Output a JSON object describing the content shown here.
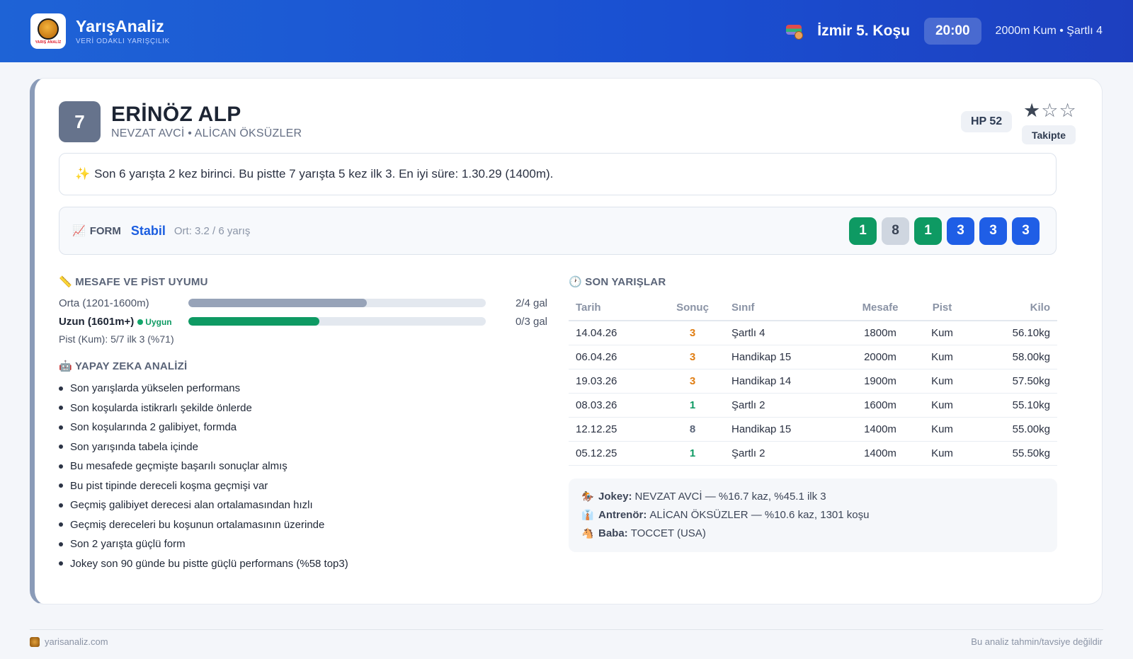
{
  "header": {
    "brand_name": "YarışAnaliz",
    "brand_tagline": "VERİ ODAKLI YARIŞÇILIK",
    "logo_mini": "YARIŞ ANALİZ",
    "race_title": "İzmir 5. Koşu",
    "race_time": "20:00",
    "race_info": "2000m Kum • Şartlı 4"
  },
  "horse": {
    "number": "7",
    "name": "ERİNÖZ ALP",
    "subtitle": "NEVZAT AVCİ • ALİCAN ÖKSÜZLER",
    "hp": "HP 52",
    "rating_stars": 1,
    "stars": "★☆☆",
    "follow_label": "Takipte"
  },
  "summary": "Son 6 yarışta 2 kez birinci. Bu pistte 7 yarışta 5 kez ilk 3. En iyi süre: 1.30.29 (1400m).",
  "form": {
    "label": "FORM",
    "state": "Stabil",
    "avg": "Ort: 3.2 / 6 yarış",
    "results": [
      "1",
      "8",
      "1",
      "3",
      "3",
      "3"
    ]
  },
  "distance": {
    "title": "MESAFE VE PİST UYUMU",
    "rows": [
      {
        "label": "Orta (1201-1600m)",
        "value": "2/4 gal",
        "fill": 0.6,
        "color": "#97a3b8",
        "tag": ""
      },
      {
        "label": "Uzun (1601m+)",
        "value": "0/3 gal",
        "fill": 0.44,
        "color": "#0e9a63",
        "tag": "Uygun"
      }
    ],
    "pist_note": "Pist (Kum): 5/7 ilk 3 (%71)"
  },
  "ai": {
    "title": "YAPAY ZEKA ANALİZİ",
    "items": [
      "Son yarışlarda yükselen performans",
      "Son koşularda istikrarlı şekilde önlerde",
      "Son koşularında 2 galibiyet, formda",
      "Son yarışında tabela içinde",
      "Bu mesafede geçmişte başarılı sonuçlar almış",
      "Bu pist tipinde dereceli koşma geçmişi var",
      "Geçmiş galibiyet derecesi alan ortalamasından hızlı",
      "Geçmiş dereceleri bu koşunun ortalamasının üzerinde",
      "Son 2 yarışta güçlü form",
      "Jokey son 90 günde bu pistte güçlü performans (%58 top3)"
    ]
  },
  "races": {
    "title": "SON YARIŞLAR",
    "headers": {
      "date": "Tarih",
      "result": "Sonuç",
      "class": "Sınıf",
      "distance": "Mesafe",
      "track": "Pist",
      "weight": "Kilo"
    },
    "rows": [
      {
        "date": "14.04.26",
        "result": "3",
        "class": "Şartlı 4",
        "distance": "1800m",
        "track": "Kum",
        "weight": "56.10kg"
      },
      {
        "date": "06.04.26",
        "result": "3",
        "class": "Handikap 15",
        "distance": "2000m",
        "track": "Kum",
        "weight": "58.00kg"
      },
      {
        "date": "19.03.26",
        "result": "3",
        "class": "Handikap 14",
        "distance": "1900m",
        "track": "Kum",
        "weight": "57.50kg"
      },
      {
        "date": "08.03.26",
        "result": "1",
        "class": "Şartlı 2",
        "distance": "1600m",
        "track": "Kum",
        "weight": "55.10kg"
      },
      {
        "date": "12.12.25",
        "result": "8",
        "class": "Handikap 15",
        "distance": "1400m",
        "track": "Kum",
        "weight": "55.00kg"
      },
      {
        "date": "05.12.25",
        "result": "1",
        "class": "Şartlı 2",
        "distance": "1400m",
        "track": "Kum",
        "weight": "55.50kg"
      }
    ]
  },
  "info": {
    "jockey_key": "Jokey:",
    "jockey_val": "NEVZAT AVCİ — %16.7 kaz, %45.1 ilk 3",
    "trainer_key": "Antrenör:",
    "trainer_val": "ALİCAN ÖKSÜZLER — %10.6 kaz, 1301 koşu",
    "sire_key": "Baba:",
    "sire_val": "TOCCET (USA)"
  },
  "footer": {
    "site": "yarisanaliz.com",
    "disclaimer": "Bu analiz tahmin/tavsiye değildir"
  },
  "colors": {
    "win": "#0e9a63",
    "place_badge": "#1f5ee6",
    "place_text": "#e07d12",
    "accent": "#1c5ee0"
  }
}
